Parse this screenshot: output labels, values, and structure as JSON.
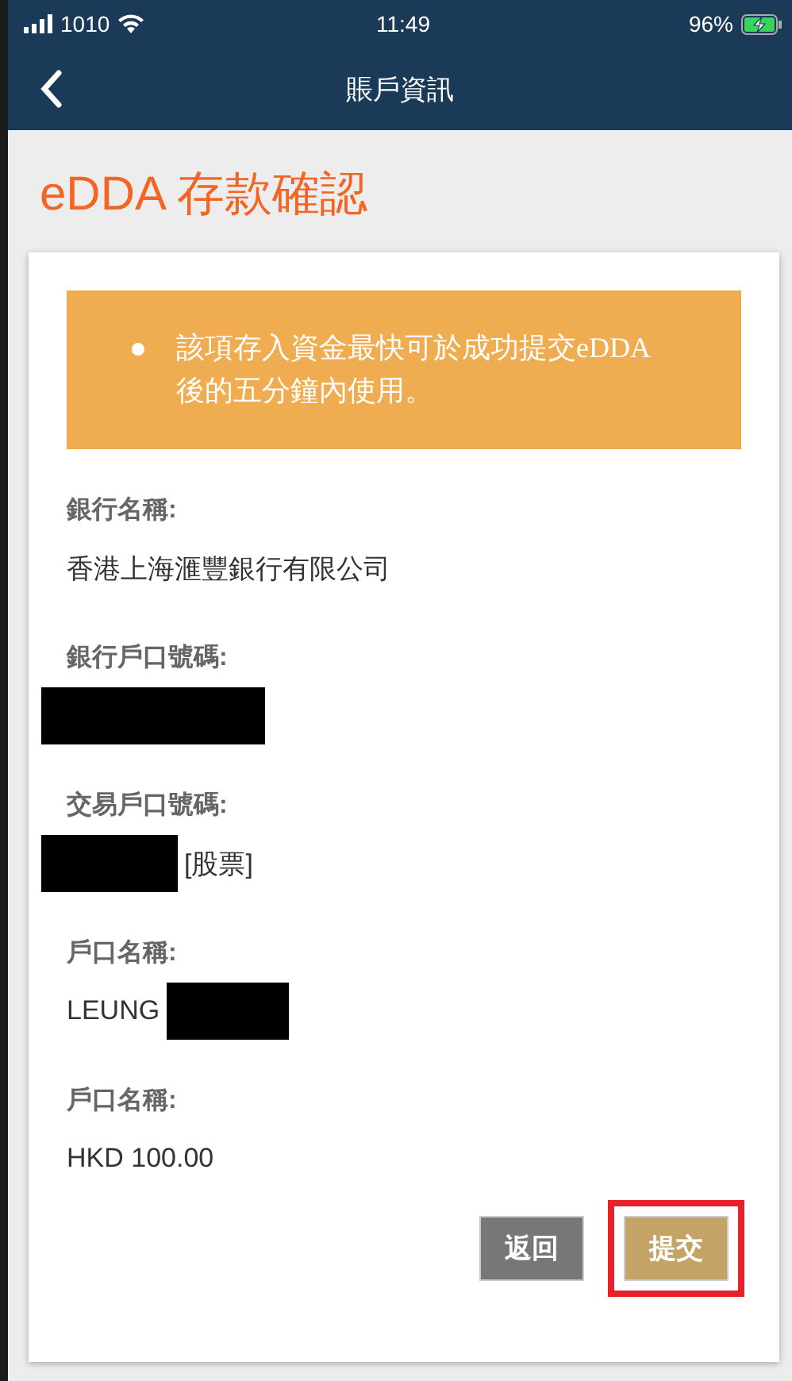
{
  "status_bar": {
    "carrier": "1010",
    "time": "11:49",
    "battery": "96%",
    "charging": true
  },
  "nav": {
    "title": "賬戶資訊"
  },
  "page_title": "eDDA 存款確認",
  "notice": {
    "items": [
      "該項存入資金最快可於成功提交eDDA後的五分鐘內使用。"
    ]
  },
  "fields": [
    {
      "label": "銀行名稱:",
      "value_parts": [
        {
          "kind": "text",
          "text": "香港上海滙豐銀行有限公司"
        }
      ]
    },
    {
      "label": "銀行戶口號碼:",
      "value_parts": [
        {
          "kind": "redaction"
        }
      ]
    },
    {
      "label": "交易戶口號碼:",
      "value_parts": [
        {
          "kind": "redaction"
        },
        {
          "kind": "text",
          "text": "[股票]"
        }
      ]
    },
    {
      "label": "戶口名稱:",
      "value_parts": [
        {
          "kind": "text",
          "text": "LEUNG"
        },
        {
          "kind": "redaction"
        }
      ]
    },
    {
      "label": "戶口名稱:",
      "value_parts": [
        {
          "kind": "text",
          "text": "HKD 100.00"
        }
      ]
    }
  ],
  "buttons": [
    {
      "label": "返回",
      "kind": "secondary",
      "highlighted": false
    },
    {
      "label": "提交",
      "kind": "primary",
      "highlighted": true
    }
  ]
}
